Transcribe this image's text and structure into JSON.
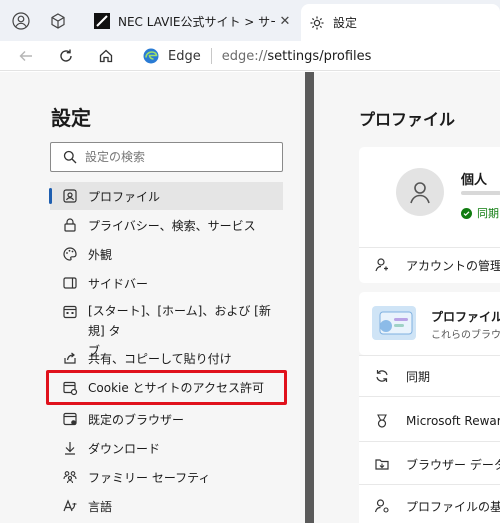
{
  "tabbar": {
    "tabs": [
      {
        "title": "NEC LAVIE公式サイト > サービス＆サ",
        "active": false
      },
      {
        "title": "設定",
        "active": true
      }
    ]
  },
  "addressbar": {
    "browser_label": "Edge",
    "url_host": "edge://",
    "url_path": "settings/profiles"
  },
  "sidebar": {
    "title": "設定",
    "search_placeholder": "設定の検索",
    "items": [
      {
        "label": "プロファイル",
        "icon": "profile-icon",
        "selected": true
      },
      {
        "label": "プライバシー、検索、サービス",
        "icon": "privacy-lock-icon"
      },
      {
        "label": "外観",
        "icon": "appearance-palette-icon"
      },
      {
        "label": "サイドバー",
        "icon": "sidebar-icon"
      },
      {
        "label_line1": "[スタート]、[ホーム]、および [新規] タ",
        "label_line2": "ブ",
        "icon": "start-home-icon"
      },
      {
        "label": "共有、コピーして貼り付け",
        "icon": "share-icon"
      },
      {
        "label": "Cookie とサイトのアクセス許可",
        "icon": "cookie-permissions-icon",
        "highlighted": true
      },
      {
        "label": "既定のブラウザー",
        "icon": "default-browser-icon"
      },
      {
        "label": "ダウンロード",
        "icon": "download-icon"
      },
      {
        "label": "ファミリー セーフティ",
        "icon": "family-icon"
      },
      {
        "label": "言語",
        "icon": "language-icon"
      }
    ]
  },
  "main": {
    "title": "プロファイル",
    "profile": {
      "name": "個人",
      "sync_status": "同期"
    },
    "account_manage": "アカウントの管理",
    "promo": {
      "title": "プロファイル設",
      "subtitle": "これらのブラウザ"
    },
    "rows": [
      {
        "label": "同期",
        "icon": "sync-icon"
      },
      {
        "label": "Microsoft Rewar",
        "icon": "rewards-icon"
      },
      {
        "label": "ブラウザー データのイ",
        "icon": "import-data-icon"
      },
      {
        "label": "プロファイルの基本",
        "icon": "profile-preferences-icon"
      }
    ]
  },
  "colors": {
    "accent": "#1f5fb0",
    "highlight_border": "#e0121c",
    "sync_green": "#107c10"
  }
}
